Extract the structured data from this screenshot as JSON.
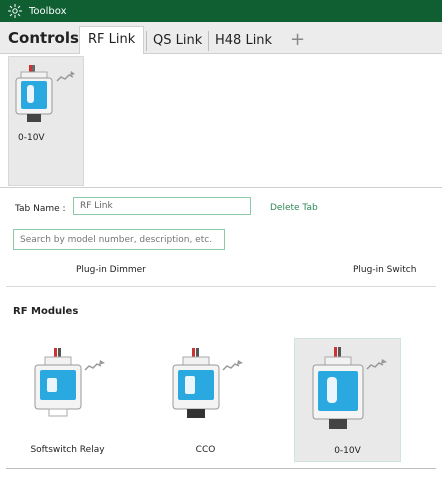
{
  "window": {
    "title": "Toolbox",
    "icon": "sun-icon"
  },
  "tabs": {
    "section_label": "Controls",
    "items": [
      {
        "label": "RF Link",
        "active": true
      },
      {
        "label": "QS Link",
        "active": false
      },
      {
        "label": "H48 Link",
        "active": false
      }
    ],
    "add_label": "+"
  },
  "tray": {
    "items": [
      {
        "label": "0-10V",
        "icon": "device-icon"
      }
    ]
  },
  "tab_settings": {
    "name_label": "Tab Name :",
    "name_value": "RF Link",
    "delete_label": "Delete Tab"
  },
  "search": {
    "placeholder": "Search by model number, description, etc."
  },
  "categories": [
    "Plug-in Dimmer",
    "Plug-in Switch"
  ],
  "modules": {
    "title": "RF Modules",
    "items": [
      {
        "label": "Softswitch Relay",
        "icon": "rf-module-icon"
      },
      {
        "label": "CCO",
        "icon": "rf-module-icon"
      },
      {
        "label": "0-10V",
        "icon": "rf-module-icon",
        "selected": true
      }
    ]
  },
  "colors": {
    "titlebar": "#0f5f33",
    "accent": "#2e8b57",
    "device": "#2aa8e0"
  }
}
